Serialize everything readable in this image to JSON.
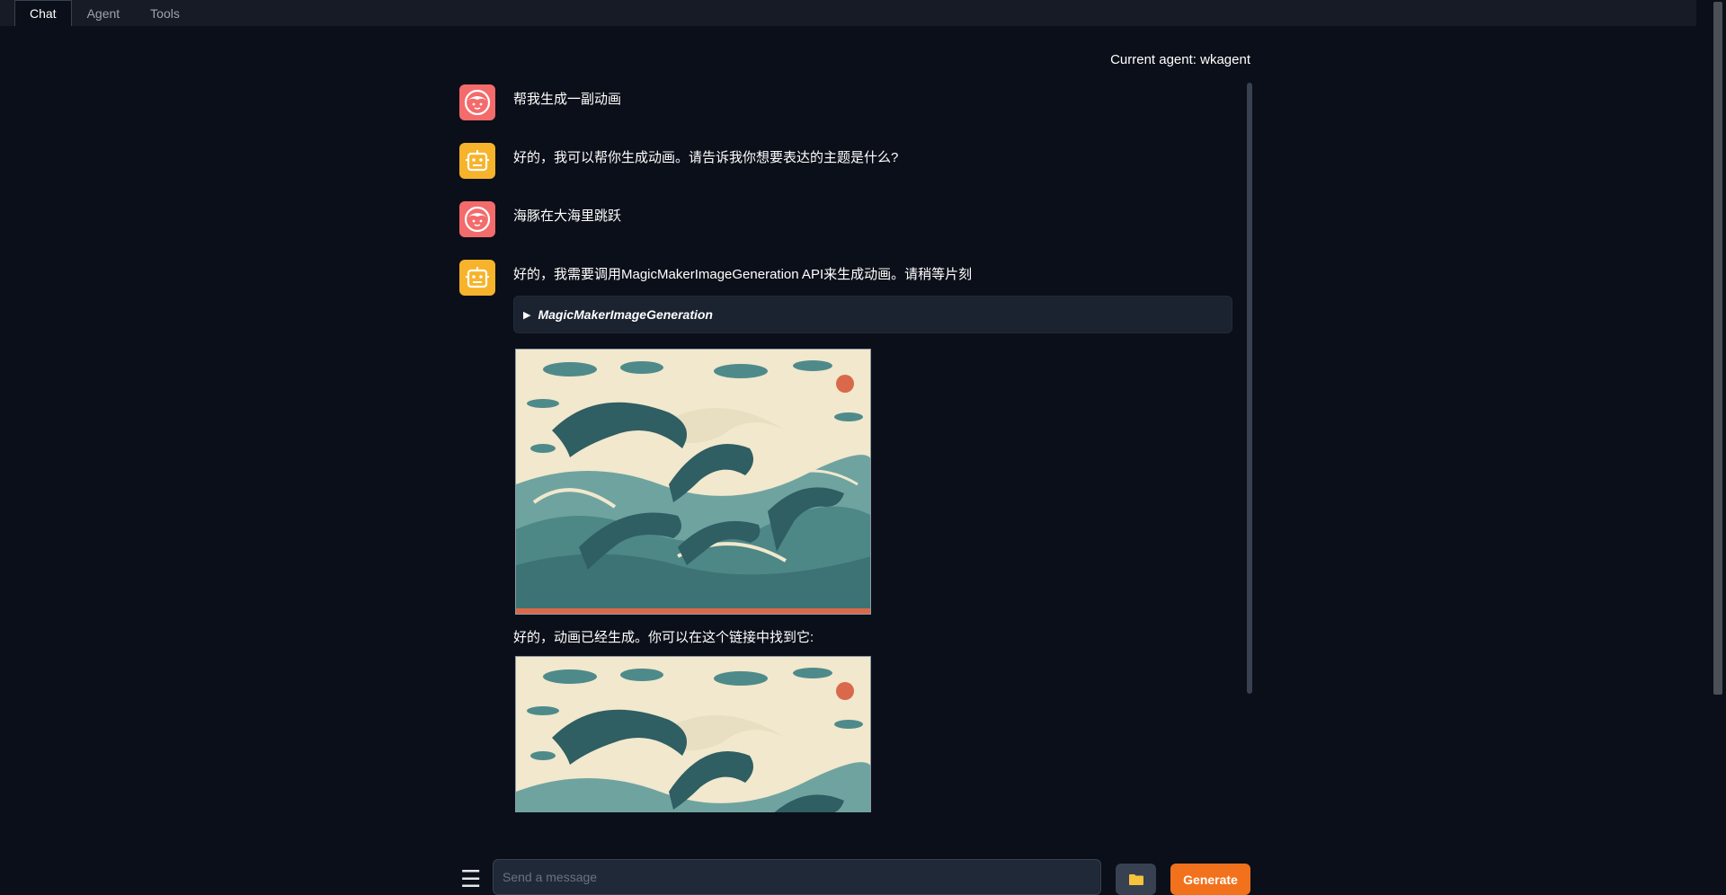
{
  "tabs": [
    {
      "label": "Chat",
      "active": true
    },
    {
      "label": "Agent",
      "active": false
    },
    {
      "label": "Tools",
      "active": false
    }
  ],
  "current_agent": {
    "label": "Current agent: ",
    "name": "wkagent"
  },
  "messages": [
    {
      "role": "user",
      "text": "帮我生成一副动画"
    },
    {
      "role": "bot",
      "text": "好的，我可以帮你生成动画。请告诉我你想要表达的主题是什么?"
    },
    {
      "role": "user",
      "text": "海豚在大海里跳跃"
    },
    {
      "role": "bot",
      "text": "好的，我需要调用MagicMakerImageGeneration API来生成动画。请稍等片刻"
    }
  ],
  "tool_call": {
    "name": "MagicMakerImageGeneration",
    "collapsed": true
  },
  "result_caption": "好的，动画已经生成。你可以在这个链接中找到它:",
  "input": {
    "placeholder": "Send a message",
    "value": ""
  },
  "buttons": {
    "generate": "Generate",
    "upload_icon": "folder-icon",
    "menu_icon": "menu-icon"
  },
  "colors": {
    "background": "#0b0f19",
    "accent": "#f2711c",
    "user_avatar": "#f46b6b",
    "bot_avatar": "#f7b32b"
  }
}
